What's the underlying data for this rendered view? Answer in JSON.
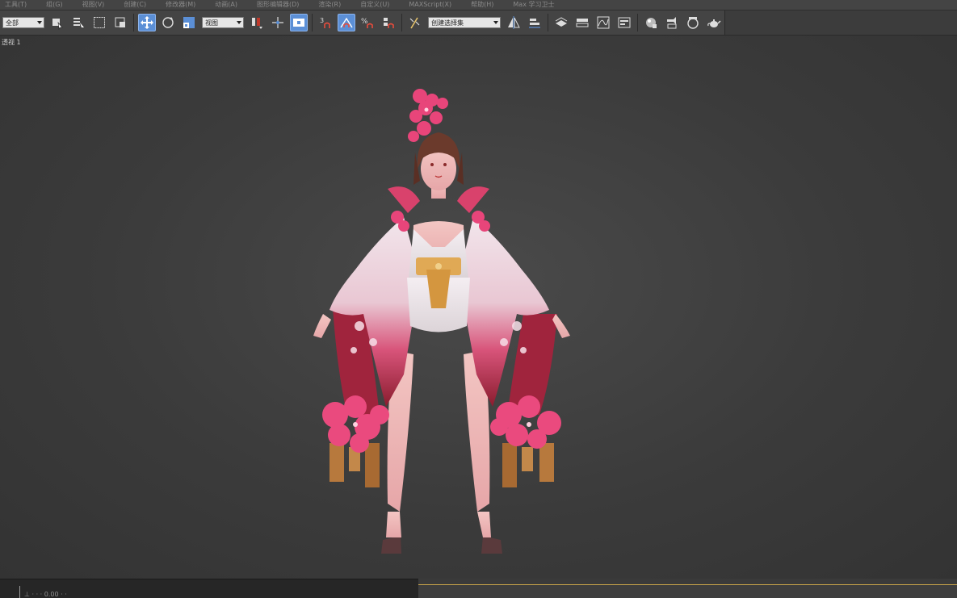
{
  "menu": {
    "items": [
      "工具(T)",
      "组(G)",
      "视图(V)",
      "创建(C)",
      "修改器(M)",
      "动画(A)",
      "图形编辑器(D)",
      "渲染(R)",
      "自定义(U)",
      "MAXScript(X)",
      "帮助(H)",
      "Max 学习卫士"
    ]
  },
  "toolbar": {
    "filter_combo": "全部",
    "ref_coord_combo": "视图",
    "selection_set_combo": "创建选择集"
  },
  "viewport": {
    "label": "透视 1"
  },
  "status": {
    "text": "⊥ ·  ·   ·  0.00   ·  ·"
  },
  "colors": {
    "background": "#3a3a3a",
    "toolbar": "#444444",
    "active_tool": "#5b8fd6",
    "status_accent": "#c9a44a"
  }
}
